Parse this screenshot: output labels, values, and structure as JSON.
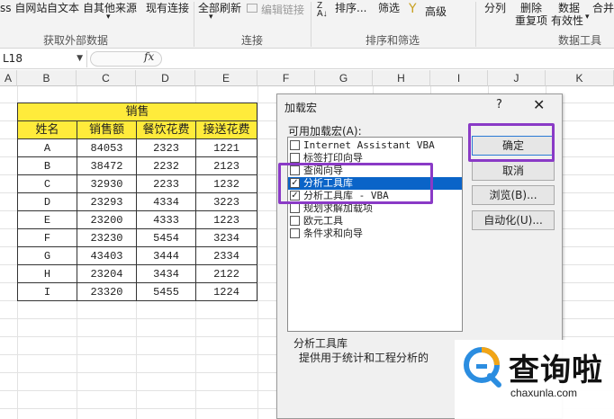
{
  "ribbon": {
    "items": [
      {
        "label": "ss 自网站"
      },
      {
        "label": "自文本"
      },
      {
        "label": "自其他来源"
      },
      {
        "label": "现有连接"
      },
      {
        "label": "全部刷新"
      },
      {
        "label": "编辑链接"
      },
      {
        "label": "排序..."
      },
      {
        "label": "筛选"
      },
      {
        "label": "高级"
      },
      {
        "label": "分列"
      },
      {
        "label": "删除"
      },
      {
        "label": "数据"
      },
      {
        "label": "合并"
      },
      {
        "label": "重复项"
      },
      {
        "label": "有效性"
      }
    ],
    "groups": [
      "获取外部数据",
      "连接",
      "排序和筛选",
      "数据工具"
    ]
  },
  "formula_bar": {
    "name_box": "L18",
    "fx": "fx"
  },
  "columns": [
    "A",
    "B",
    "C",
    "D",
    "E",
    "F",
    "G",
    "H",
    "I",
    "J",
    "K"
  ],
  "table": {
    "title": "销售",
    "headers": [
      "姓名",
      "销售额",
      "餐饮花费",
      "接送花费"
    ],
    "rows": [
      [
        "A",
        "84053",
        "2323",
        "1221"
      ],
      [
        "B",
        "38472",
        "2232",
        "2123"
      ],
      [
        "C",
        "32930",
        "2233",
        "1232"
      ],
      [
        "D",
        "23293",
        "4334",
        "3223"
      ],
      [
        "E",
        "23200",
        "4333",
        "1223"
      ],
      [
        "F",
        "23230",
        "5454",
        "3234"
      ],
      [
        "G",
        "43403",
        "3444",
        "2334"
      ],
      [
        "H",
        "23204",
        "3434",
        "2122"
      ],
      [
        "I",
        "23320",
        "5455",
        "1224"
      ]
    ]
  },
  "dialog": {
    "title": "加载宏",
    "help": "?",
    "close": "✕",
    "list_label": "可用加载宏(A):",
    "items": [
      {
        "label": "Internet Assistant VBA",
        "checked": false
      },
      {
        "label": "标签打印向导",
        "checked": false
      },
      {
        "label": "查阅向导",
        "checked": false
      },
      {
        "label": "分析工具库",
        "checked": true,
        "selected": true
      },
      {
        "label": "分析工具库 - VBA",
        "checked": true
      },
      {
        "label": "规划求解加载项",
        "checked": false
      },
      {
        "label": "欧元工具",
        "checked": false
      },
      {
        "label": "条件求和向导",
        "checked": false
      }
    ],
    "buttons": {
      "ok": "确定",
      "cancel": "取消",
      "browse": "浏览(B)...",
      "automation": "自动化(U)..."
    },
    "description_title": "分析工具库",
    "description_text": "提供用于统计和工程分析的"
  },
  "watermark": {
    "brand": "查询啦",
    "url": "chaxunla.com"
  },
  "colors": {
    "header_fill": "#ffeb3b",
    "highlight": "#8a3ac6",
    "selection": "#0a64c8"
  }
}
